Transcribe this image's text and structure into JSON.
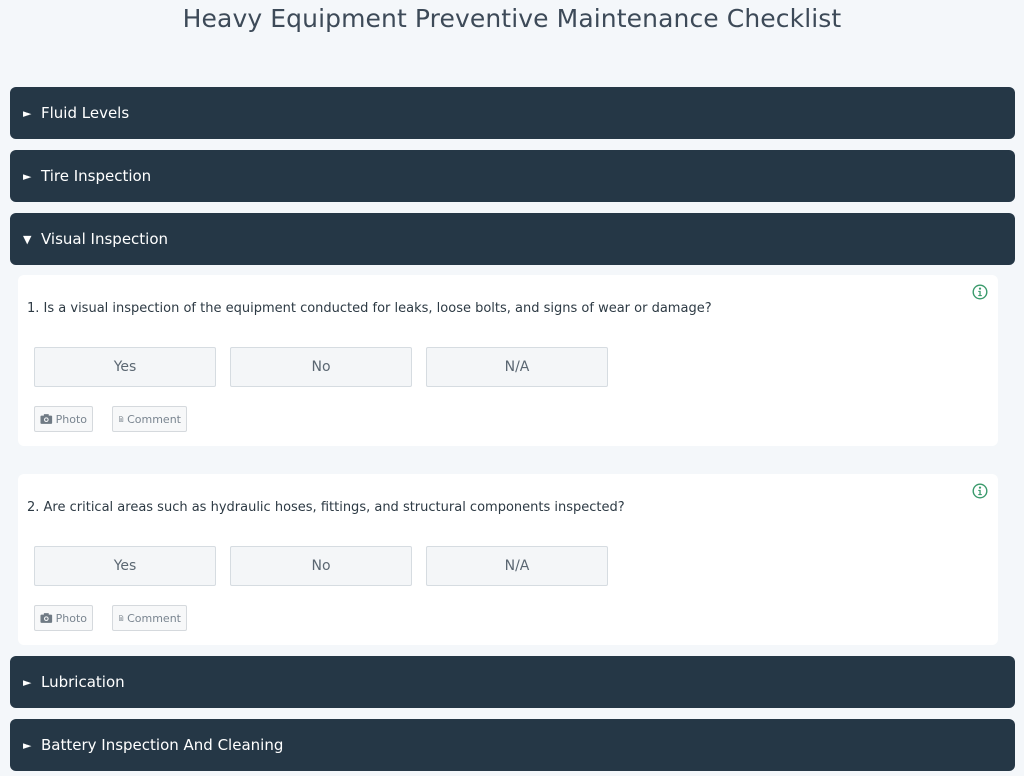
{
  "page": {
    "title": "Heavy Equipment Preventive Maintenance Checklist"
  },
  "sections": [
    {
      "label": "Fluid Levels",
      "caret": "►",
      "expanded": false
    },
    {
      "label": "Tire Inspection",
      "caret": "►",
      "expanded": false
    },
    {
      "label": "Visual Inspection",
      "caret": "▼",
      "expanded": true
    },
    {
      "label": "Lubrication",
      "caret": "►",
      "expanded": false
    },
    {
      "label": "Battery Inspection And Cleaning",
      "caret": "►",
      "expanded": false
    }
  ],
  "questions": [
    {
      "text": "1. Is a visual inspection of the equipment conducted for leaks, loose bolts, and signs of wear or damage?",
      "answers": {
        "yes": "Yes",
        "no": "No",
        "na": "N/A"
      },
      "photo_label": "Photo",
      "comment_label": "Comment"
    },
    {
      "text": "2. Are critical areas such as hydraulic hoses, fittings, and structural components inspected?",
      "answers": {
        "yes": "Yes",
        "no": "No",
        "na": "N/A"
      },
      "photo_label": "Photo",
      "comment_label": "Comment"
    }
  ],
  "colors": {
    "header_bg": "#253746",
    "info_icon": "#3a9a6c",
    "page_bg": "#f4f7fa"
  },
  "icons": {
    "info": "info-icon",
    "camera": "camera-icon",
    "document": "document-icon"
  }
}
